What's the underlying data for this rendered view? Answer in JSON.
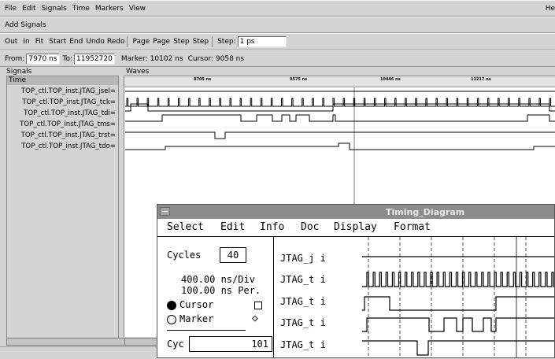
{
  "menu": [
    "File",
    "Edit",
    "Signals",
    "Time",
    "Markers",
    "View"
  ],
  "menu_right": "He",
  "add_signals": "Add Signals",
  "toolbar": [
    "Out",
    "In",
    "Fit",
    "Start",
    "End",
    "Undo",
    "Redo",
    "Page",
    "Page",
    "Step",
    "Step"
  ],
  "step_label": "Step:",
  "step_value": "1 ps",
  "range": {
    "from_label": "From:",
    "from_value": "7970 ns",
    "to_label": "To:",
    "to_value": "11952720",
    "marker": "Marker: 10102 ns",
    "cursor": "Cursor: 9058 ns"
  },
  "signals_title": "Signals",
  "waves_title": "Waves",
  "time_label": "Time",
  "signals": [
    "TOP_ctl.TOP_inst.JTAG_jsel=",
    "TOP_ctl.TOP_inst.JTAG_tck=",
    "TOP_ctl.TOP_inst.JTAG_tdi=",
    "TOP_ctl.TOP_inst.JTAG_tms=",
    "TOP_ctl.TOP_inst.JTAG_trst=",
    "TOP_ctl.TOP_inst.JTAG_tdo="
  ],
  "ruler": [
    "8705 ns",
    "9575 ns",
    "10446 ns",
    "11217 ns"
  ],
  "timing": {
    "title": "Timing_Diagram",
    "menu": [
      "Select",
      "Edit",
      "Info",
      "Doc",
      "Display",
      "Format"
    ],
    "cycles_label": "Cycles",
    "cycles_value": "40",
    "ns_div": "400.00 ns/Div",
    "ns_per": "100.00 ns Per.",
    "cursor_label": "Cursor",
    "marker_label": "Marker",
    "cyc_label": "Cyc",
    "cyc_value": "101",
    "signals": [
      "JTAG_j i",
      "JTAG_t i",
      "JTAG_t i",
      "JTAG_t i",
      "JTAG_t i"
    ]
  },
  "colors": {
    "bg": "#d4d4d4",
    "wave": "#000000",
    "title_bar": "#8c8c8c"
  }
}
